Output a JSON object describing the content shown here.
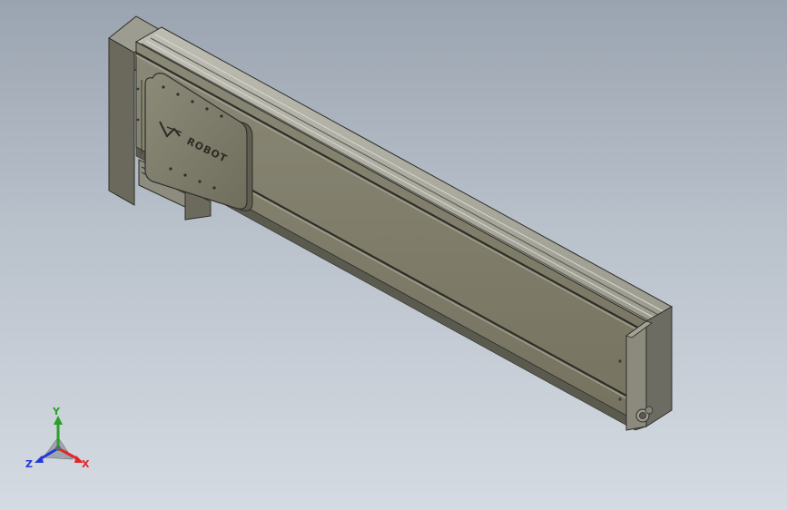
{
  "viewport": {
    "background_top": "#9aa4b0",
    "background_bottom": "#d5dbe2"
  },
  "model": {
    "logo_text": "ROBOT",
    "logo_mark": "robot-logo-mark",
    "body_color": "#7f7d6c",
    "end_cap_color": "#6d6c62"
  },
  "triad": {
    "x_label": "X",
    "y_label": "Y",
    "z_label": "Z",
    "x_color": "#e0282a",
    "y_color": "#2aa02a",
    "z_color": "#2438d8"
  }
}
